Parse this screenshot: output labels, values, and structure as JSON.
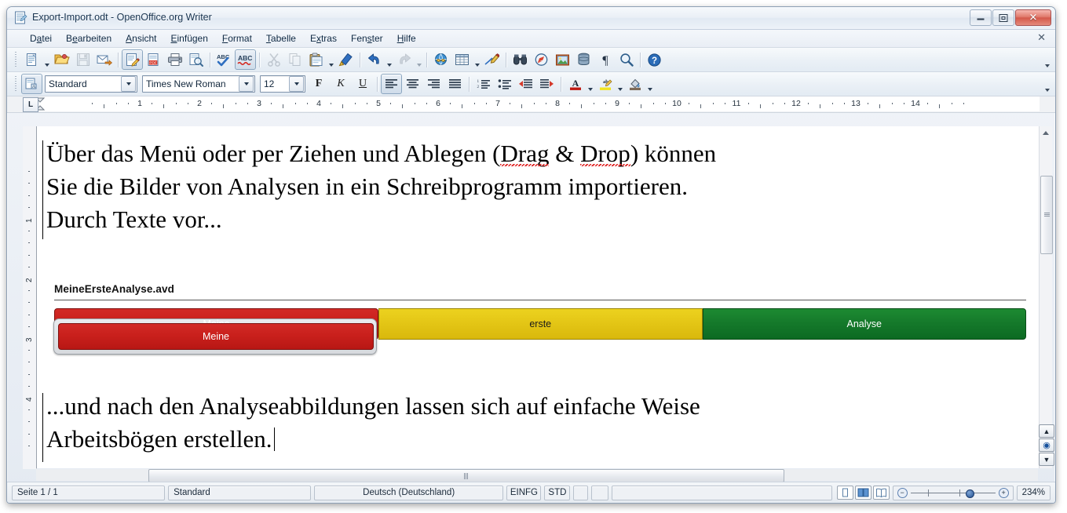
{
  "window": {
    "title": "Export-Import.odt - OpenOffice.org Writer",
    "icon": "writer-document-icon",
    "controls": {
      "minimize": "–",
      "restore": "❐",
      "close": "✕"
    }
  },
  "menubar": {
    "items": [
      {
        "name": "datei",
        "pre": "D",
        "accel": "a",
        "post": "tei"
      },
      {
        "name": "bearbeiten",
        "pre": "B",
        "accel": "e",
        "post": "arbeiten"
      },
      {
        "name": "ansicht",
        "pre": "",
        "accel": "A",
        "post": "nsicht"
      },
      {
        "name": "einfuegen",
        "pre": "",
        "accel": "E",
        "post": "infügen"
      },
      {
        "name": "format",
        "pre": "",
        "accel": "F",
        "post": "ormat"
      },
      {
        "name": "tabelle",
        "pre": "",
        "accel": "T",
        "post": "abelle"
      },
      {
        "name": "extras",
        "pre": "E",
        "accel": "x",
        "post": "tras"
      },
      {
        "name": "fenster",
        "pre": "Fen",
        "accel": "s",
        "post": "ter"
      },
      {
        "name": "hilfe",
        "pre": "",
        "accel": "H",
        "post": "ilfe"
      }
    ],
    "close_label": "✕"
  },
  "standard_toolbar": {
    "buttons": [
      {
        "name": "new-document-icon",
        "label": "Neu",
        "dropdown": true,
        "enabled": true
      },
      {
        "name": "open-folder-icon",
        "label": "Öffnen",
        "enabled": true
      },
      {
        "name": "save-icon",
        "label": "Speichern",
        "enabled": false
      },
      {
        "name": "email-document-icon",
        "label": "Dokument als E-Mail",
        "enabled": true
      },
      {
        "name": "edit-file-icon",
        "label": "Datei bearbeiten",
        "enabled": true,
        "active": true
      },
      {
        "name": "export-pdf-icon",
        "label": "Direktes Exportieren als PDF",
        "enabled": true
      },
      {
        "name": "print-icon",
        "label": "Datei direkt drucken",
        "enabled": true
      },
      {
        "name": "print-preview-icon",
        "label": "Seitenansicht",
        "enabled": true
      },
      {
        "name": "spelling-check-icon",
        "label": "Rechtschreibung",
        "enabled": true
      },
      {
        "name": "autospellcheck-icon",
        "label": "AutoKorrektur",
        "enabled": true,
        "active": true
      },
      {
        "name": "cut-icon",
        "label": "Ausschneiden",
        "enabled": false
      },
      {
        "name": "copy-icon",
        "label": "Kopieren",
        "enabled": false
      },
      {
        "name": "paste-icon",
        "label": "Einfügen",
        "dropdown": true,
        "enabled": true
      },
      {
        "name": "clone-formatting-icon",
        "label": "Pinsel für Formatierung",
        "enabled": true
      },
      {
        "name": "undo-icon",
        "label": "Rückgängig",
        "dropdown": true,
        "enabled": true
      },
      {
        "name": "redo-icon",
        "label": "Wiederherstellen",
        "dropdown": true,
        "enabled": false
      },
      {
        "name": "hyperlink-icon",
        "label": "Hyperlink",
        "enabled": true
      },
      {
        "name": "table-icon",
        "label": "Tabelle",
        "dropdown": true,
        "enabled": true
      },
      {
        "name": "draw-functions-icon",
        "label": "Zeichnungsfunktionen",
        "enabled": true
      },
      {
        "name": "find-replace-icon",
        "label": "Suchen & Ersetzen",
        "enabled": true
      },
      {
        "name": "navigator-icon",
        "label": "Navigator",
        "enabled": true
      },
      {
        "name": "gallery-icon",
        "label": "Gallery",
        "enabled": true
      },
      {
        "name": "data-sources-icon",
        "label": "Datenquellen",
        "enabled": true
      },
      {
        "name": "formatting-marks-icon",
        "label": "Steuerzeichen",
        "enabled": true
      },
      {
        "name": "zoom-icon",
        "label": "Maßstab",
        "enabled": true
      },
      {
        "name": "help-icon",
        "label": "Hilfe",
        "enabled": true
      }
    ]
  },
  "formatting_toolbar": {
    "style_selector_icon": "paragraph-style-icon",
    "paragraph_style": "Standard",
    "font_name": "Times New Roman",
    "font_size": "12",
    "bold_label": "F",
    "italic_label": "K",
    "underline_label": "U",
    "align_left": "align-left-icon",
    "align_center": "align-center-icon",
    "align_right": "align-right-icon",
    "align_justify": "align-justify-icon",
    "numbered_list": "numbered-list-icon",
    "bullet_list": "bullet-list-icon",
    "decrease_indent": "decrease-indent-icon",
    "increase_indent": "increase-indent-icon",
    "font_color": "font-color-icon",
    "highlighting": "highlighting-icon",
    "background_color": "background-color-icon"
  },
  "ruler": {
    "tab_selector": "L",
    "horizontal_numbers": [
      "1",
      "2",
      "3",
      "4",
      "5",
      "6",
      "7",
      "8",
      "9",
      "10",
      "11",
      "12",
      "13",
      "14"
    ],
    "vertical_numbers": [
      "1",
      "2",
      "3",
      "4"
    ]
  },
  "document": {
    "paragraph_1_line_1_a": "Über das Menü oder per Ziehen und Ablegen (",
    "paragraph_1_line_1_b": "Drag",
    "paragraph_1_line_1_c": " & ",
    "paragraph_1_line_1_d": "Drop",
    "paragraph_1_line_1_e": ") können",
    "paragraph_1_line_2": "Sie die Bilder von Analysen in ein Schreibprogramm importieren.",
    "paragraph_1_line_3": "Durch Texte vor...",
    "paragraph_2_line_1": "...und nach den Analyseabbildungen lassen sich auf einfache Weise",
    "paragraph_2_line_2": "Arbeitsbögen erstellen."
  },
  "analysis_object": {
    "title": "MeineErsteAnalyse.avd",
    "segments": [
      {
        "name": "segment-meine",
        "label": "Meine",
        "color": "#c9201c",
        "selected": true
      },
      {
        "name": "segment-erste",
        "label": "erste",
        "color": "#e3c515",
        "selected": false
      },
      {
        "name": "segment-analyse",
        "label": "Analyse",
        "color": "#14782a",
        "selected": false
      }
    ]
  },
  "statusbar": {
    "page": "Seite 1 / 1",
    "style": "Standard",
    "language": "Deutsch (Deutschland)",
    "insert_mode": "EINFG",
    "selection_mode": "STD",
    "modified": "",
    "signature": "",
    "section": "",
    "view_single_page": "single-page-view-icon",
    "view_multi_page": "multi-page-view-icon",
    "view_book": "book-view-icon",
    "zoom_out": "−",
    "zoom_in": "+",
    "zoom_level": "234%"
  }
}
